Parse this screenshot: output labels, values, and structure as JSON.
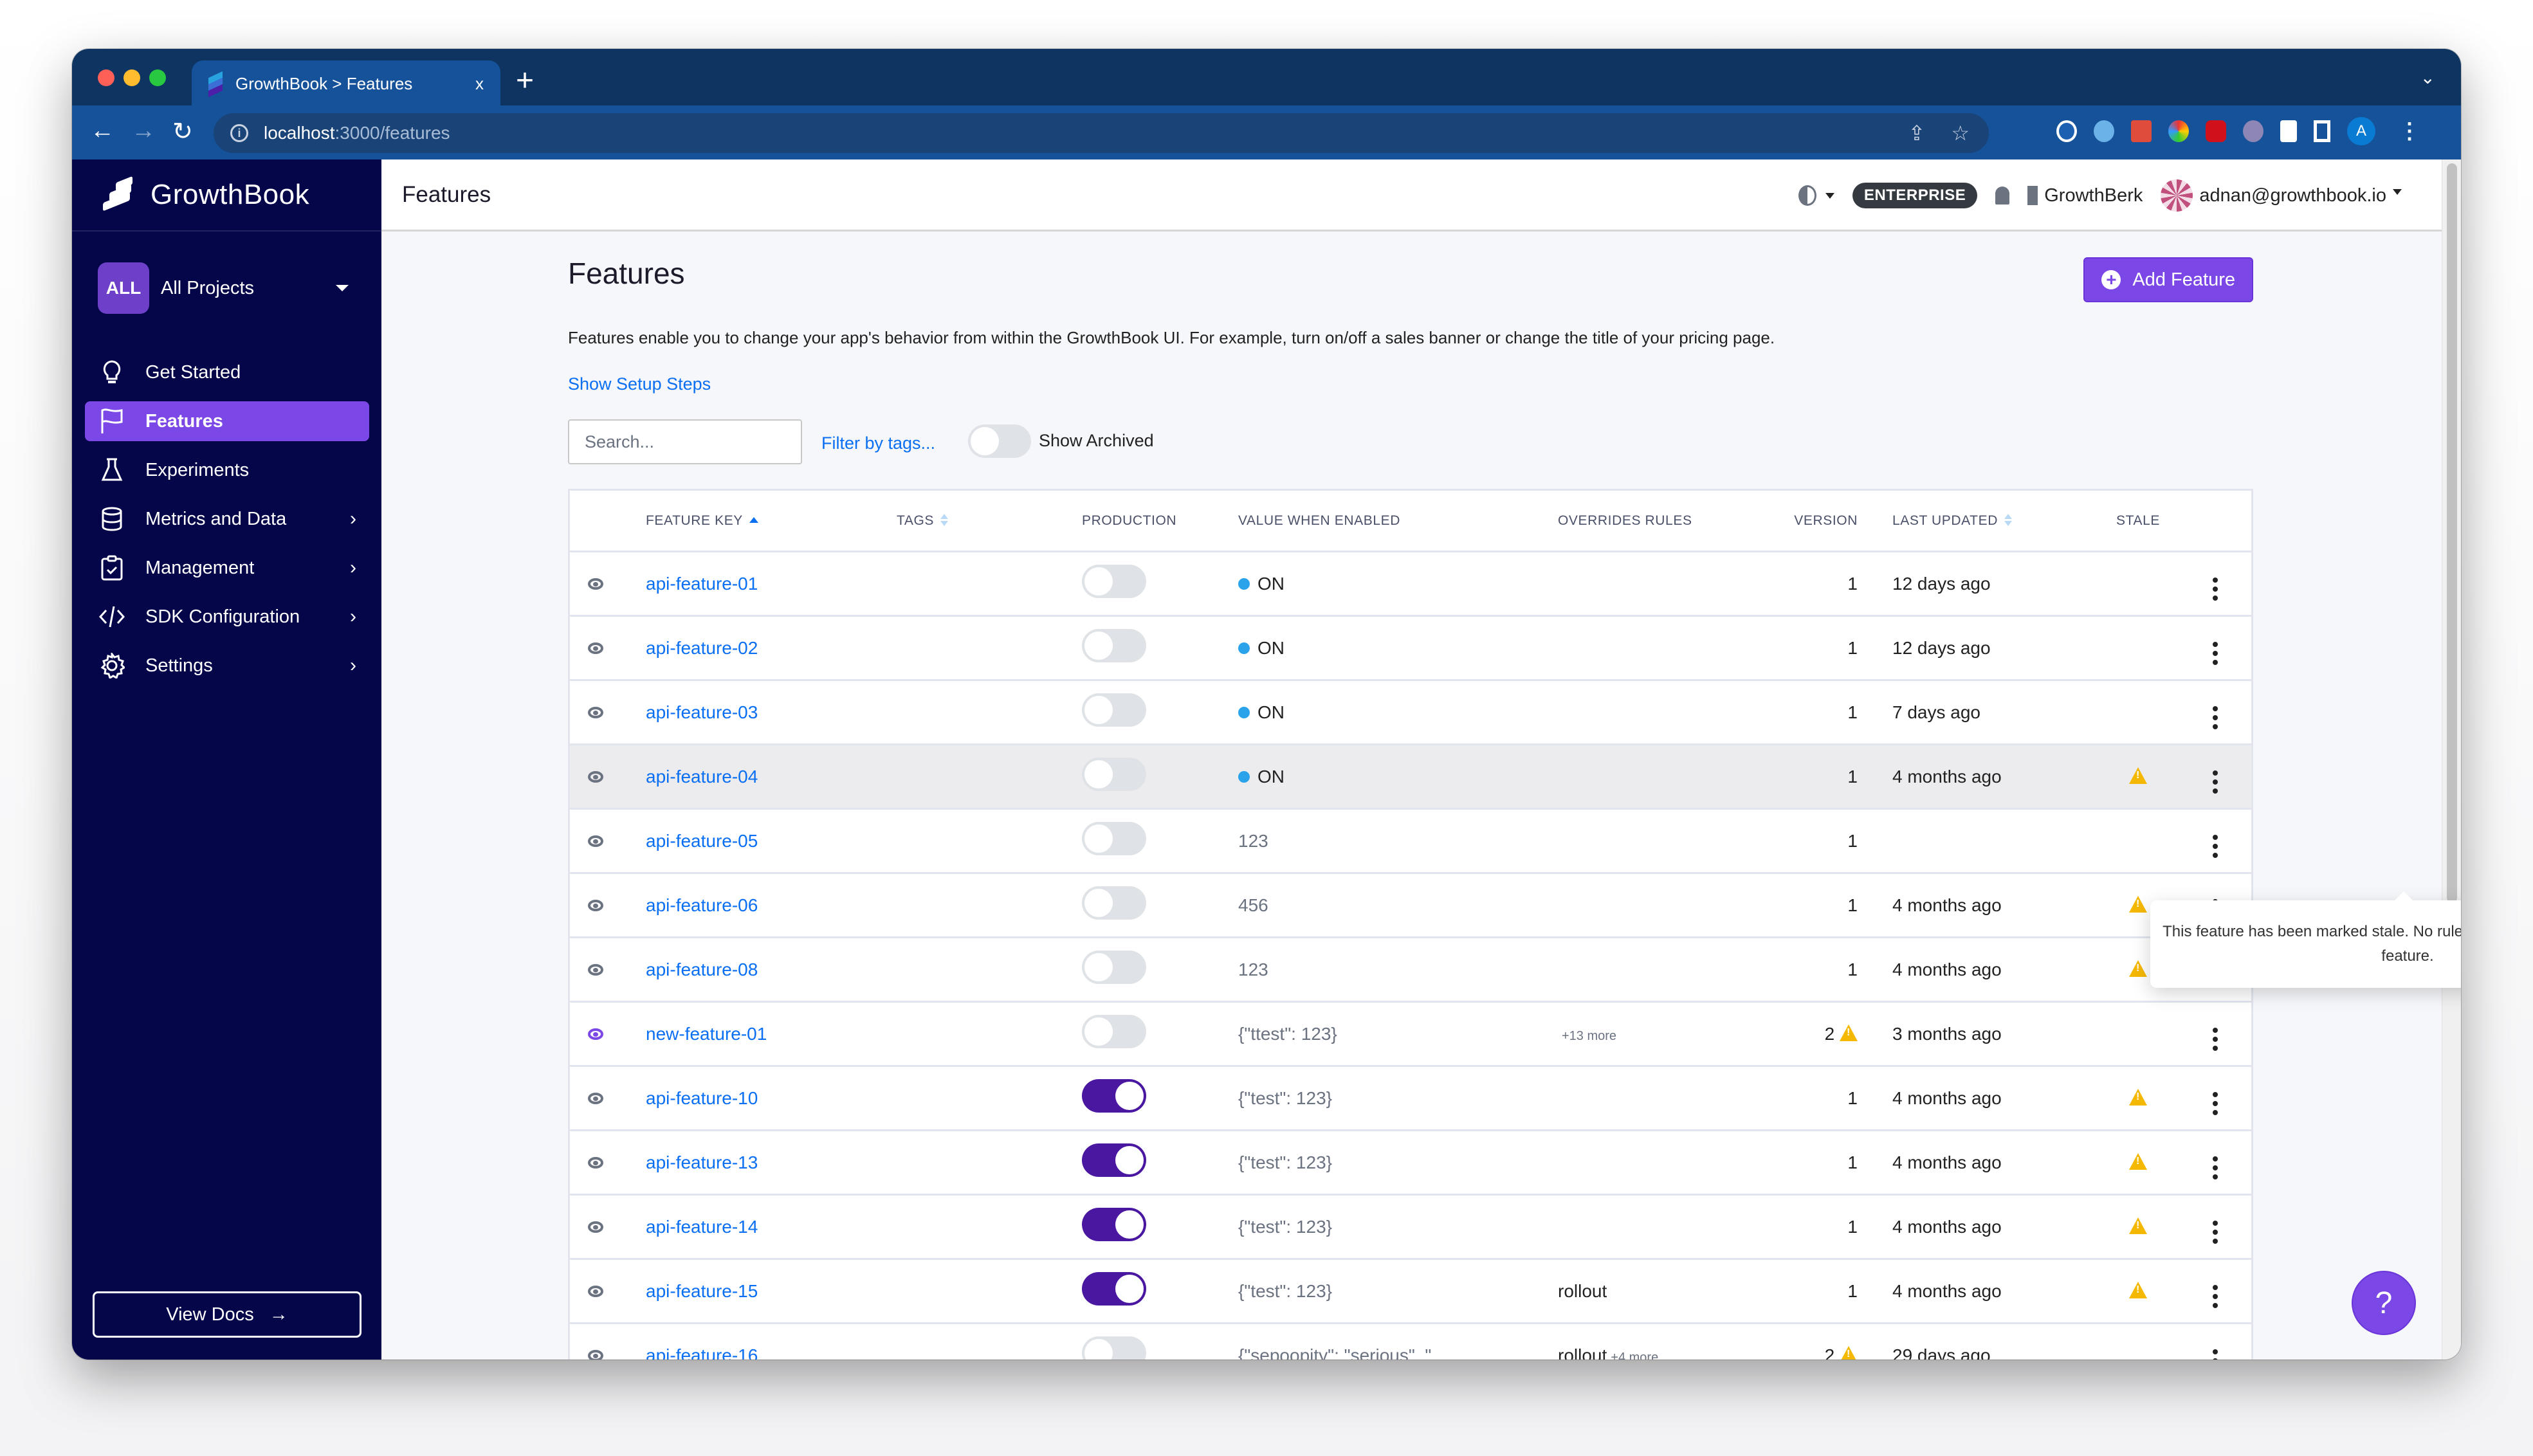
{
  "browser": {
    "tab_title": "GrowthBook > Features",
    "tab_close": "x",
    "new_tab": "+",
    "url_host": "localhost",
    "url_path": ":3000/features",
    "profile_initial": "A"
  },
  "sidebar": {
    "logo_text": "GrowthBook",
    "project_badge": "ALL",
    "project_name": "All Projects",
    "items": [
      {
        "label": "Get Started",
        "icon": "lightbulb-icon",
        "active": false,
        "chevron": false
      },
      {
        "label": "Features",
        "icon": "flag-icon",
        "active": true,
        "chevron": false
      },
      {
        "label": "Experiments",
        "icon": "flask-icon",
        "active": false,
        "chevron": false
      },
      {
        "label": "Metrics and Data",
        "icon": "database-icon",
        "active": false,
        "chevron": true
      },
      {
        "label": "Management",
        "icon": "clipboard-check-icon",
        "active": false,
        "chevron": true
      },
      {
        "label": "SDK Configuration",
        "icon": "code-icon",
        "active": false,
        "chevron": true
      },
      {
        "label": "Settings",
        "icon": "gear-icon",
        "active": false,
        "chevron": true
      }
    ],
    "chevron": "›",
    "view_docs": "View Docs",
    "view_docs_arrow": "→"
  },
  "topbar": {
    "title": "Features",
    "plan_badge": "ENTERPRISE",
    "org_name": "GrowthBerk",
    "user_email": "adnan@growthbook.io"
  },
  "page": {
    "title": "Features",
    "add_button": "Add Feature",
    "description": "Features enable you to change your app's behavior from within the GrowthBook UI. For example, turn on/off a sales banner or change the title of your pricing page.",
    "setup_link": "Show Setup Steps",
    "search_placeholder": "Search...",
    "filter_tags": "Filter by tags...",
    "show_archived": "Show Archived",
    "show_archived_on": false
  },
  "table": {
    "headers": {
      "feature_key": "FEATURE KEY",
      "tags": "TAGS",
      "production": "PRODUCTION",
      "value": "VALUE WHEN ENABLED",
      "overrides": "OVERRIDES RULES",
      "version": "VERSION",
      "last_updated": "LAST UPDATED",
      "stale": "STALE"
    },
    "rows": [
      {
        "key": "api-feature-01",
        "production": false,
        "value": "ON",
        "value_type": "boolean",
        "overrides": "",
        "overrides_more": "",
        "version": "1",
        "version_warn": false,
        "updated": "12 days ago",
        "stale": false,
        "eye": "gray"
      },
      {
        "key": "api-feature-02",
        "production": false,
        "value": "ON",
        "value_type": "boolean",
        "overrides": "",
        "overrides_more": "",
        "version": "1",
        "version_warn": false,
        "updated": "12 days ago",
        "stale": false,
        "eye": "gray"
      },
      {
        "key": "api-feature-03",
        "production": false,
        "value": "ON",
        "value_type": "boolean",
        "overrides": "",
        "overrides_more": "",
        "version": "1",
        "version_warn": false,
        "updated": "7 days ago",
        "stale": false,
        "eye": "gray"
      },
      {
        "key": "api-feature-04",
        "production": false,
        "value": "ON",
        "value_type": "boolean",
        "overrides": "",
        "overrides_more": "",
        "version": "1",
        "version_warn": false,
        "updated": "4 months ago",
        "stale": true,
        "eye": "gray",
        "hover": true
      },
      {
        "key": "api-feature-05",
        "production": false,
        "value": "123",
        "value_type": "json",
        "overrides": "",
        "overrides_more": "",
        "version": "1",
        "version_warn": false,
        "updated": "",
        "stale": false,
        "eye": "gray"
      },
      {
        "key": "api-feature-06",
        "production": false,
        "value": "456",
        "value_type": "json",
        "overrides": "",
        "overrides_more": "",
        "version": "1",
        "version_warn": false,
        "updated": "4 months ago",
        "stale": true,
        "eye": "gray"
      },
      {
        "key": "api-feature-08",
        "production": false,
        "value": "123",
        "value_type": "json",
        "overrides": "",
        "overrides_more": "",
        "version": "1",
        "version_warn": false,
        "updated": "4 months ago",
        "stale": true,
        "eye": "gray"
      },
      {
        "key": "new-feature-01",
        "production": false,
        "value": "{\"ttest\": 123}",
        "value_type": "json",
        "overrides": "",
        "overrides_more": "+13 more",
        "version": "2",
        "version_warn": true,
        "updated": "3 months ago",
        "stale": false,
        "eye": "purple"
      },
      {
        "key": "api-feature-10",
        "production": true,
        "value": "{\"test\": 123}",
        "value_type": "json",
        "overrides": "",
        "overrides_more": "",
        "version": "1",
        "version_warn": false,
        "updated": "4 months ago",
        "stale": true,
        "eye": "gray"
      },
      {
        "key": "api-feature-13",
        "production": true,
        "value": "{\"test\": 123}",
        "value_type": "json",
        "overrides": "",
        "overrides_more": "",
        "version": "1",
        "version_warn": false,
        "updated": "4 months ago",
        "stale": true,
        "eye": "gray"
      },
      {
        "key": "api-feature-14",
        "production": true,
        "value": "{\"test\": 123}",
        "value_type": "json",
        "overrides": "",
        "overrides_more": "",
        "version": "1",
        "version_warn": false,
        "updated": "4 months ago",
        "stale": true,
        "eye": "gray"
      },
      {
        "key": "api-feature-15",
        "production": true,
        "value": "{\"test\": 123}",
        "value_type": "json",
        "overrides": "rollout",
        "overrides_more": "",
        "version": "1",
        "version_warn": false,
        "updated": "4 months ago",
        "stale": true,
        "eye": "gray"
      },
      {
        "key": "api-feature-16",
        "production": false,
        "value": "{\"sepoopity\": \"serious\", \"...",
        "value_type": "json",
        "overrides": "rollout",
        "overrides_more": "+4 more",
        "version": "2",
        "version_warn": true,
        "updated": "29 days ago",
        "stale": false,
        "eye": "gray"
      }
    ]
  },
  "tooltip": {
    "text": "This feature has been marked stale. No rules have been defined for this feature."
  },
  "help_button": "?",
  "colors": {
    "sidebar_bg": "#05054a",
    "accent_purple": "#7b47e6",
    "toggle_on": "#4a18a0",
    "link_blue": "#0a6ff2",
    "warning": "#f5b800",
    "boolean_dot": "#2aa3ea"
  }
}
